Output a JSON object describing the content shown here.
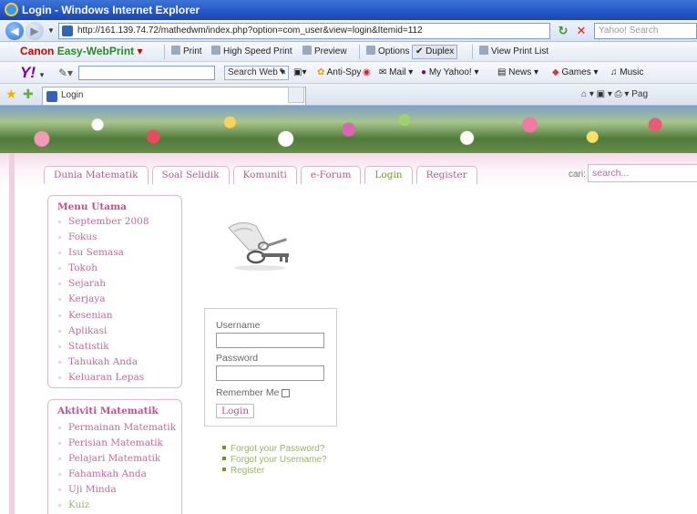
{
  "window": {
    "title": "Login - Windows Internet Explorer"
  },
  "address": {
    "url": "http://161.139.74.72/mathedwm/index.php?option=com_user&view=login&Itemid=112",
    "search_placeholder": "Yahoo! Search"
  },
  "toolbar1": {
    "brand_canon": "Canon",
    "brand_ewp": "Easy-WebPrint",
    "print": "Print",
    "high_speed_print": "High Speed Print",
    "preview": "Preview",
    "options": "Options",
    "duplex": "Duplex",
    "view_print_list": "View Print List"
  },
  "toolbar2": {
    "logo": "Y!",
    "search_web": "Search Web",
    "anti_spy": "Anti-Spy",
    "mail": "Mail",
    "my_yahoo": "My Yahoo!",
    "news": "News",
    "games": "Games",
    "music": "Music"
  },
  "favbar": {
    "tab_title": "Login",
    "right_tools": "⌂ ▾  ▣ ▾  ⎙ ▾  Pag"
  },
  "site": {
    "nav": [
      "Dunia Matematik",
      "Soal Selidik",
      "Komuniti",
      "e-Forum",
      "Login",
      "Register"
    ],
    "search_label": "cari:",
    "search_placeholder": "search..."
  },
  "menu_utama": {
    "title": "Menu Utama",
    "items": [
      "September 2008",
      "Fokus",
      "Isu Semasa",
      "Tokoh",
      "Sejarah",
      "Kerjaya",
      "Kesenian",
      "Aplikasi",
      "Statistik",
      "Tahukah Anda",
      "Keluaran Lepas"
    ]
  },
  "aktiviti": {
    "title": "Aktiviti Matematik",
    "items": [
      "Permainan Matematik",
      "Perisian Matematik",
      "Pelajari Matematik",
      "Fahamkah Anda",
      "Uji Minda",
      "Kuiz"
    ]
  },
  "login": {
    "username_label": "Username",
    "password_label": "Password",
    "remember_label": "Remember Me",
    "button": "Login",
    "links": [
      "Forgot your Password?",
      "Forgot your Username?",
      "Register"
    ]
  }
}
